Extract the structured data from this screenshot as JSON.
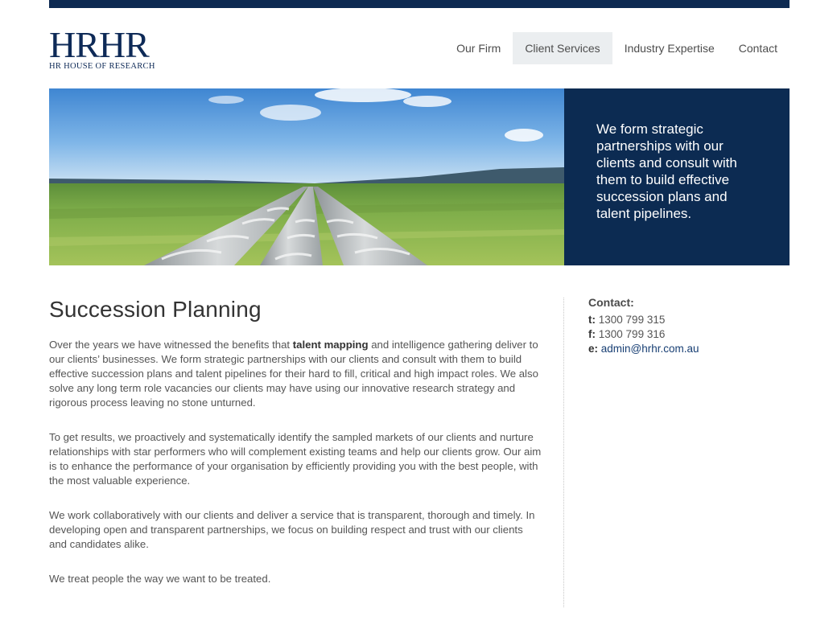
{
  "header": {
    "logo_mark": "HRHR",
    "logo_subtitle": "HR HOUSE OF RESEARCH"
  },
  "nav": {
    "items": [
      {
        "label": "Our Firm",
        "active": false
      },
      {
        "label": "Client Services",
        "active": true
      },
      {
        "label": "Industry Expertise",
        "active": false
      },
      {
        "label": "Contact",
        "active": false
      }
    ]
  },
  "hero": {
    "tagline": "We form strategic partnerships with our clients and consult with them to build effective succession plans and talent pipelines."
  },
  "main": {
    "title": "Succession Planning",
    "p1_before": "Over the years we have witnessed the benefits that ",
    "p1_bold": "talent mapping",
    "p1_after": " and intelligence gathering deliver to our clients’ businesses. We form strategic partnerships with our clients and consult with them to build effective succession plans and talent pipelines for their hard to fill, critical and high impact roles. We also solve any long term role vacancies our clients may have using our innovative research strategy and rigorous process leaving no stone unturned.",
    "p2": "To get results, we proactively and systematically identify the sampled markets of our clients and nurture relationships with star performers who will complement existing teams and help our clients grow. Our aim is to enhance the performance of your organisation by efficiently providing you with the best people, with the most valuable experience.",
    "p3": "We work collaboratively with our clients and deliver a service that is transparent, thorough and timely. In developing open and transparent partnerships, we focus on building respect and trust with our clients and candidates alike.",
    "p4": "We treat people the way we want to be treated."
  },
  "sidebar": {
    "heading": "Contact:",
    "phone_label": "t:",
    "phone": "1300 799 315",
    "fax_label": "f:",
    "fax": "1300 799 316",
    "email_label": "e:",
    "email": "admin@hrhr.com.au"
  },
  "colors": {
    "brand_navy": "#0c2b52",
    "nav_active_bg": "#ebeef0",
    "link": "#173e73"
  }
}
